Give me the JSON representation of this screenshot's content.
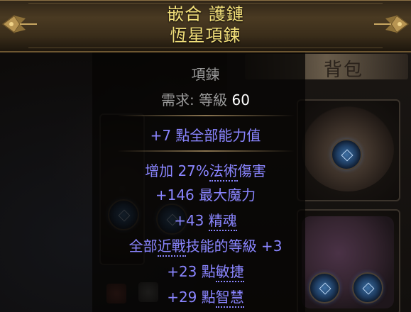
{
  "inventory": {
    "title": "背包"
  },
  "item": {
    "name": "嵌合 護鏈",
    "base_type": "恆星項鍊",
    "item_class": "項鍊",
    "requirement_label": "需求: ",
    "requirement_level_label": "等級 ",
    "requirement_level": "60",
    "implicit": "+7 點全部能力值",
    "mods": [
      {
        "prefix": "增加 27%",
        "term": "法術",
        "suffix": "傷害"
      },
      {
        "prefix": "+146 最大",
        "term": "魔力",
        "suffix": ""
      },
      {
        "prefix": "+43 ",
        "term": "精魂",
        "suffix": ""
      },
      {
        "prefix": "全部",
        "term": "近戰",
        "suffix": "技能的等級 +3"
      },
      {
        "prefix": "+23 點",
        "term": "敏捷",
        "suffix": ""
      },
      {
        "prefix": "+29 點",
        "term": "智慧",
        "suffix": ""
      }
    ]
  },
  "colors": {
    "unique_name": "#f2df7a",
    "magic_mod": "#8a85ff",
    "label_gray": "#9a9a9a",
    "value_white": "#ffffff"
  },
  "icons": [
    "ornament-corner-icon",
    "socket-gem-icon",
    "amulet-icon",
    "body-armour-icon",
    "flask-icon"
  ]
}
